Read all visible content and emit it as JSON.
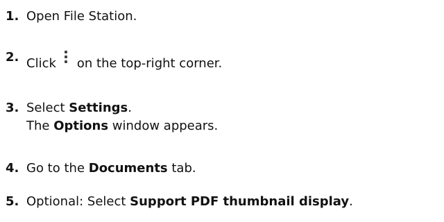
{
  "steps": [
    {
      "number": "1.",
      "text": "Open File Station."
    },
    {
      "number": "2.",
      "before": "Click",
      "icon": "more-vertical-icon",
      "after": "on the top-right corner."
    },
    {
      "number": "3.",
      "before": "Select ",
      "bold": "Settings",
      "after": ".",
      "line2_before": "The ",
      "line2_bold": "Options",
      "line2_after": " window appears."
    },
    {
      "number": "4.",
      "before": "Go to the ",
      "bold": "Documents",
      "after": " tab."
    },
    {
      "number": "5.",
      "before": "Optional: Select ",
      "bold": "Support PDF thumbnail display",
      "after": "."
    }
  ]
}
